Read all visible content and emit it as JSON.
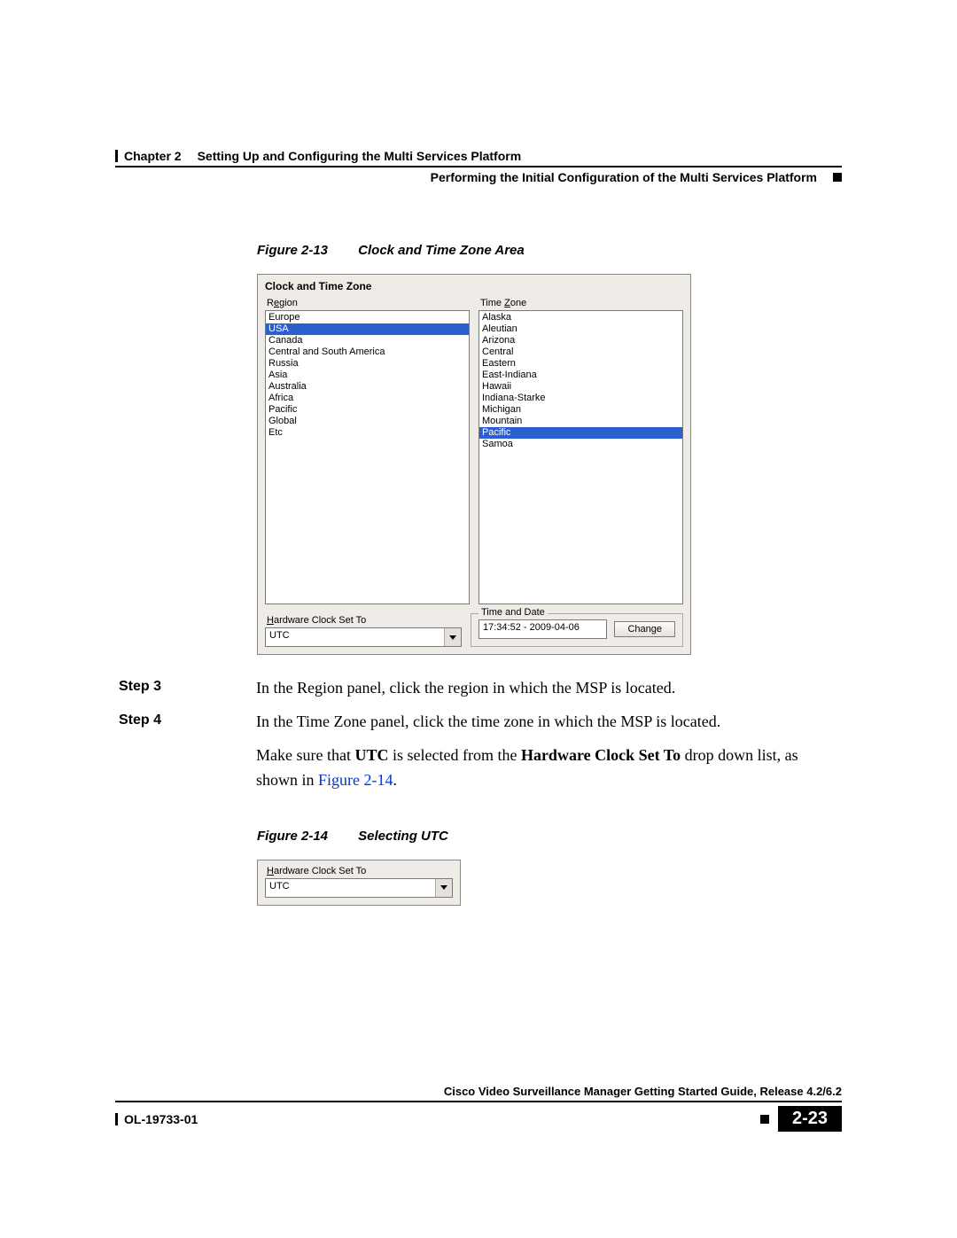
{
  "header": {
    "chapter_label": "Chapter 2",
    "chapter_title": "Setting Up and Configuring the Multi Services Platform",
    "section_title": "Performing the Initial Configuration of the Multi Services Platform"
  },
  "figure1": {
    "label": "Figure 2-13",
    "title": "Clock and Time Zone Area"
  },
  "shot1": {
    "title": "Clock and Time Zone",
    "region_label_pre": "R",
    "region_label_u": "e",
    "region_label_post": "gion",
    "timezone_label_pre": "Time ",
    "timezone_label_u": "Z",
    "timezone_label_post": "one",
    "regions": [
      "Europe",
      "USA",
      "Canada",
      "Central and South America",
      "Russia",
      "Asia",
      "Australia",
      "Africa",
      "Pacific",
      "Global",
      "Etc"
    ],
    "region_selected": "USA",
    "timezones": [
      "Alaska",
      "Aleutian",
      "Arizona",
      "Central",
      "Eastern",
      "East-Indiana",
      "Hawaii",
      "Indiana-Starke",
      "Michigan",
      "Mountain",
      "Pacific",
      "Samoa"
    ],
    "timezone_selected": "Pacific",
    "hw_label_u": "H",
    "hw_label_rest": "ardware Clock Set To",
    "hw_value": "UTC",
    "td_legend": "Time and Date",
    "td_value": "17:34:52 - 2009-04-06",
    "change_btn": "Change"
  },
  "steps": {
    "s3_label": "Step 3",
    "s3_text": "In the Region panel, click the region in which the MSP is located.",
    "s4_label": "Step 4",
    "s4_text": "In the Time Zone panel, click the time zone in which the MSP is located.",
    "s4_extra_pre": "Make sure that ",
    "s4_extra_b1": "UTC",
    "s4_extra_mid1": " is selected from the ",
    "s4_extra_b2": "Hardware Clock Set To",
    "s4_extra_mid2": " drop down list, as shown in ",
    "s4_extra_link": "Figure 2-14",
    "s4_extra_post": "."
  },
  "figure2": {
    "label": "Figure 2-14",
    "title": "Selecting UTC"
  },
  "shot2": {
    "hw_label_u": "H",
    "hw_label_rest": "ardware Clock Set To",
    "hw_value": "UTC"
  },
  "footer": {
    "guide": "Cisco Video Surveillance Manager Getting Started Guide, Release 4.2/6.2",
    "doc_id": "OL-19733-01",
    "page": "2-23"
  }
}
